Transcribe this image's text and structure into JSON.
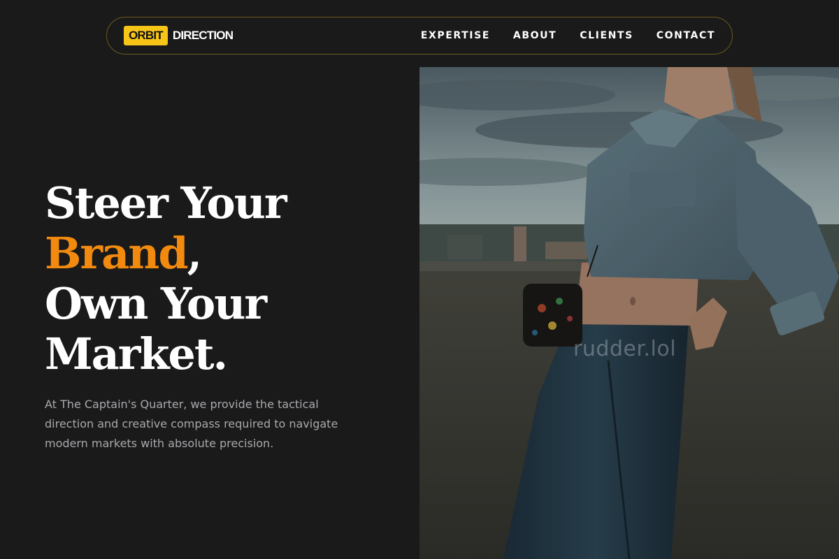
{
  "nav": {
    "logo_badge": "ORBIT",
    "logo_word": "DIRECTION",
    "links": [
      "EXPERTISE",
      "ABOUT",
      "CLIENTS",
      "CONTACT"
    ]
  },
  "hero": {
    "line1": "Steer Your",
    "accent_word": "Brand",
    "accent_punct": ",",
    "line3": "Own Your",
    "line4": "Market.",
    "description": "At The Captain's Quarter, we provide the tactical direction and creative compass required to navigate modern markets with absolute precision."
  },
  "photo": {
    "watermark": "rudder.lol"
  },
  "colors": {
    "background": "#1a1a1a",
    "accent": "#f28a0f",
    "logo_yellow": "#f7c518",
    "nav_border": "#6b5a1e",
    "body_text": "#a9a9ae"
  }
}
